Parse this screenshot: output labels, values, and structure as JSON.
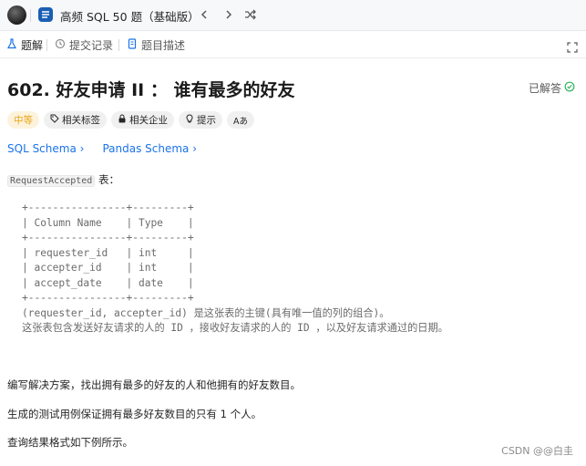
{
  "topbar": {
    "list_title": "高频 SQL 50 题（基础版）",
    "icons": [
      "avatar",
      "list-icon",
      "prev-icon",
      "next-icon",
      "shuffle-icon"
    ]
  },
  "tabs": [
    {
      "label": "题解",
      "icon": "flask-icon"
    },
    {
      "label": "提交记录",
      "icon": "history-icon"
    },
    {
      "label": "题目描述",
      "icon": "document-icon"
    }
  ],
  "problem": {
    "title": "602. 好友申请 II ： 谁有最多的好友",
    "status": "已解答",
    "tags": [
      {
        "label": "中等",
        "icon": ""
      },
      {
        "label": "相关标签",
        "icon": "tag-icon"
      },
      {
        "label": "相关企业",
        "icon": "lock-icon"
      },
      {
        "label": "提示",
        "icon": "lightbulb-icon"
      },
      {
        "label": "Aあ",
        "icon": "translate-icon"
      }
    ],
    "links": [
      "SQL Schema",
      "Pandas Schema"
    ],
    "table_name": "RequestAccepted",
    "table_suffix": " 表：",
    "schema": "+----------------+---------+\n| Column Name    | Type    |\n+----------------+---------+\n| requester_id   | int     |\n| accepter_id    | int     |\n| accept_date    | date    |\n+----------------+---------+\n(requester_id, accepter_id) 是这张表的主键(具有唯一值的列的组合)。\n这张表包含发送好友请求的人的 ID ，接收好友请求的人的 ID ，以及好友请求通过的日期。",
    "paragraphs": [
      "编写解决方案，找出拥有最多的好友的人和他拥有的好友数目。",
      "生成的测试用例保证拥有最多好友数目的只有 1 个人。",
      "查询结果格式如下例所示。"
    ]
  },
  "watermark": "CSDN @@白圭",
  "colors": {
    "accent": "#1a73e8",
    "difficulty": "#e8a317",
    "solved": "#2db55d"
  }
}
